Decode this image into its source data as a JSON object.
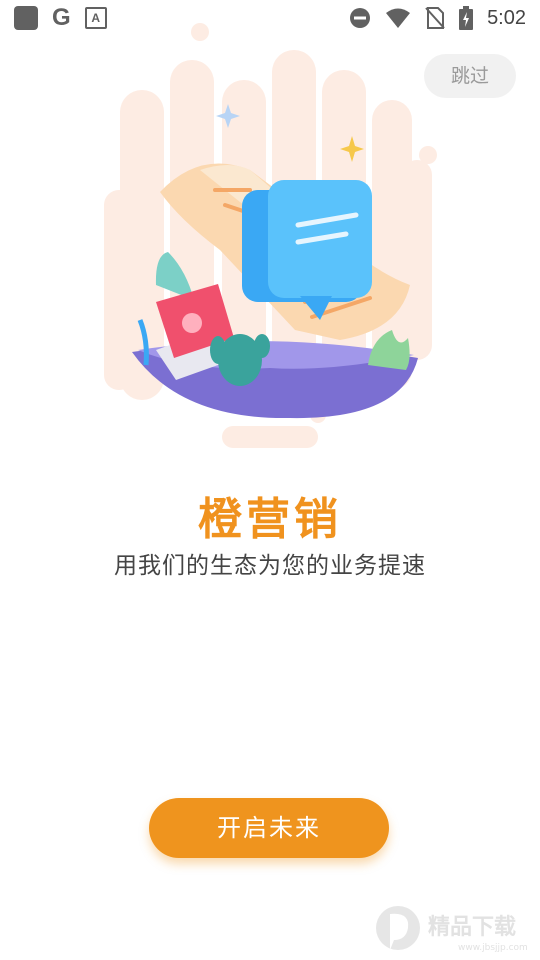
{
  "status_bar": {
    "time": "5:02",
    "left_icons": [
      "square-app-icon",
      "google-icon",
      "text-a-icon"
    ],
    "right_icons": [
      "do-not-disturb-icon",
      "wifi-icon",
      "no-sim-icon",
      "battery-charging-icon"
    ]
  },
  "skip_label": "跳过",
  "title": "橙营销",
  "subtitle": "用我们的生态为您的业务提速",
  "start_button_label": "开启未来",
  "watermark": {
    "text": "精品下载",
    "url": "www.jbsjjp.com"
  },
  "colors": {
    "accent": "#ef941e",
    "title": "#f0921e",
    "skip_bg": "#f1f1f1"
  }
}
